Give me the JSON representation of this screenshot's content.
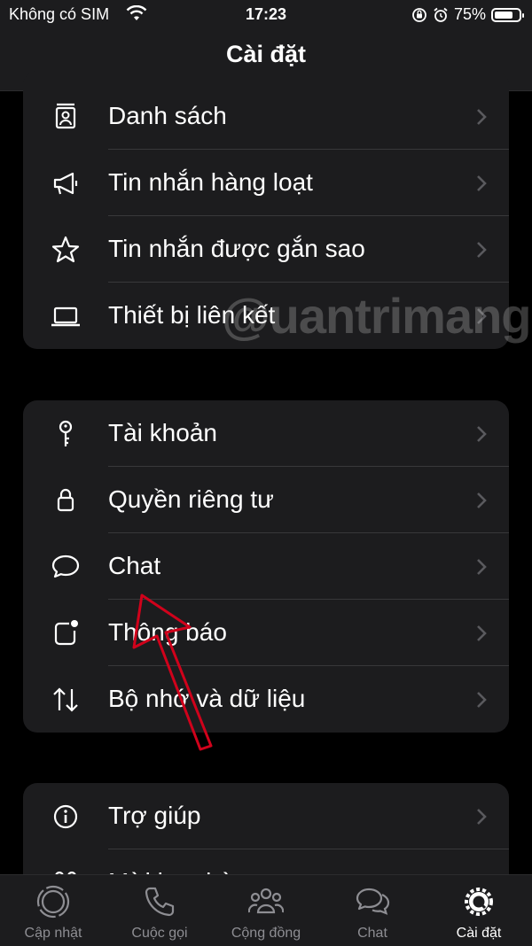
{
  "status_bar": {
    "carrier": "Không có SIM",
    "time": "17:23",
    "battery": "75%",
    "battery_level": 0.75
  },
  "header": {
    "title": "Cài đặt"
  },
  "groups": [
    {
      "rows": [
        {
          "label": "Danh sách",
          "icon": "contact-list-icon"
        },
        {
          "label": "Tin nhắn hàng loạt",
          "icon": "megaphone-icon"
        },
        {
          "label": "Tin nhắn được gắn sao",
          "icon": "star-icon"
        },
        {
          "label": "Thiết bị liên kết",
          "icon": "laptop-icon"
        }
      ]
    },
    {
      "rows": [
        {
          "label": "Tài khoản",
          "icon": "key-icon"
        },
        {
          "label": "Quyền riêng tư",
          "icon": "lock-icon"
        },
        {
          "label": "Chat",
          "icon": "chat-bubble-icon"
        },
        {
          "label": "Thông báo",
          "icon": "notification-icon"
        },
        {
          "label": "Bộ nhớ và dữ liệu",
          "icon": "storage-arrows-icon"
        }
      ]
    },
    {
      "rows": [
        {
          "label": "Trợ giúp",
          "icon": "info-icon"
        },
        {
          "label": "Mời bạn bè",
          "icon": "heart-people-icon"
        }
      ]
    }
  ],
  "watermark": "@uantrimang",
  "tabs": [
    {
      "label": "Cập nhật",
      "icon": "updates-icon",
      "active": false
    },
    {
      "label": "Cuộc gọi",
      "icon": "phone-icon",
      "active": false
    },
    {
      "label": "Cộng đồng",
      "icon": "community-icon",
      "active": false
    },
    {
      "label": "Chat",
      "icon": "chats-icon",
      "active": false
    },
    {
      "label": "Cài đặt",
      "icon": "settings-gear-icon",
      "active": true
    }
  ],
  "colors": {
    "background": "#000000",
    "card": "#1c1c1e",
    "separator": "#38383a",
    "inactive_tab": "#8e8e93",
    "annotation_arrow": "#d0021b"
  }
}
